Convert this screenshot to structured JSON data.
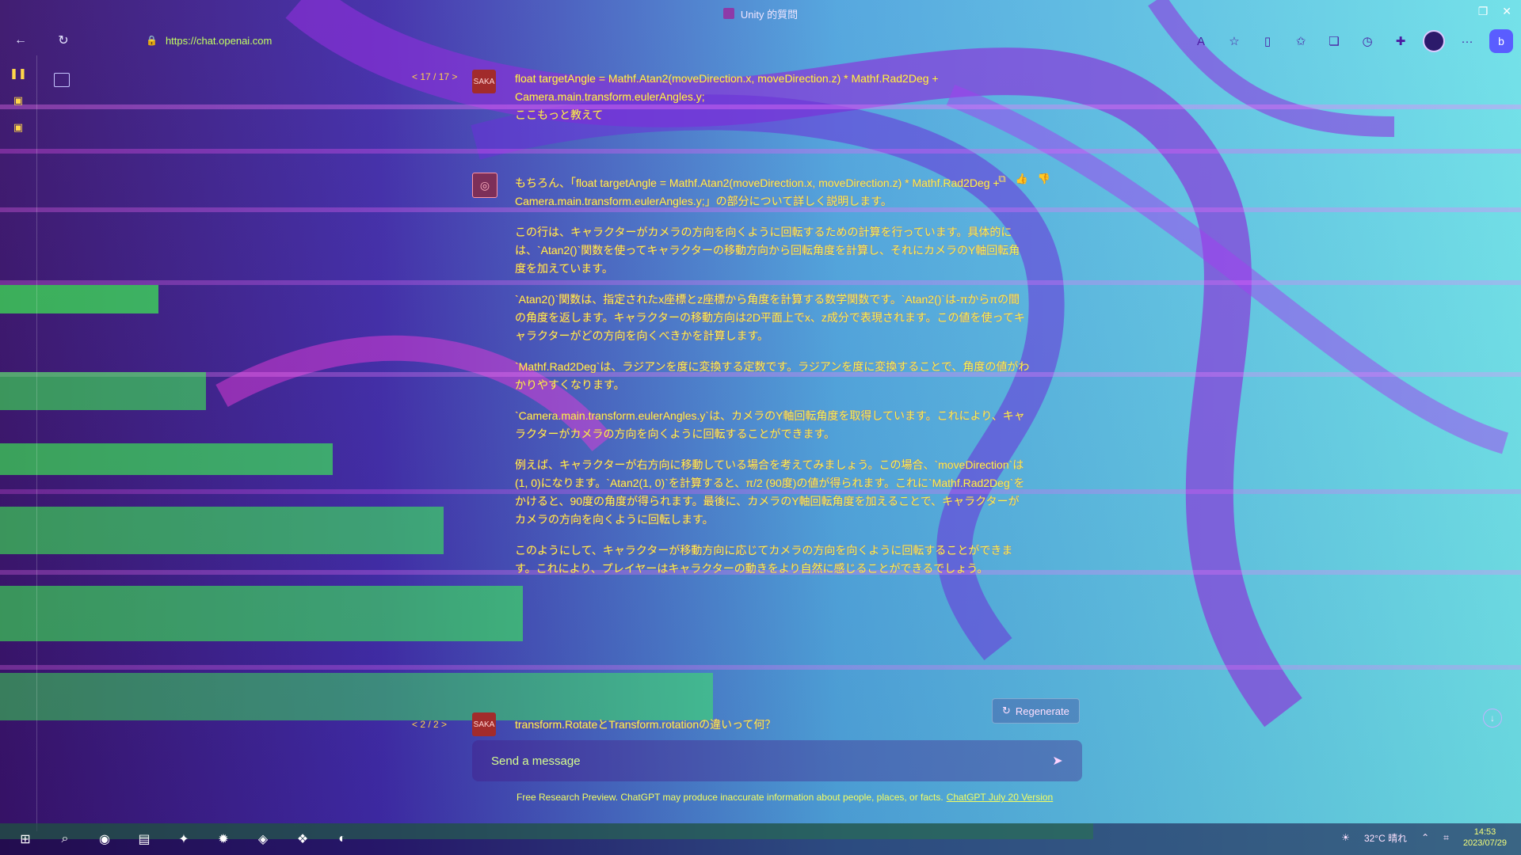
{
  "window": {
    "title": "Unity 的質問"
  },
  "browser": {
    "url": "https://chat.openai.com"
  },
  "conversation": {
    "user_message_1": {
      "pager": "< 17 / 17 >",
      "avatar_text": "SAKA",
      "line1": "float targetAngle = Mathf.Atan2(moveDirection.x, moveDirection.z) * Mathf.Rad2Deg +",
      "line2": "Camera.main.transform.eulerAngles.y;",
      "line3": "ここもっと教えて"
    },
    "assistant_message": {
      "paragraphs": [
        "もちろん、「float targetAngle = Mathf.Atan2(moveDirection.x, moveDirection.z) * Mathf.Rad2Deg + Camera.main.transform.eulerAngles.y;」の部分について詳しく説明します。",
        "この行は、キャラクターがカメラの方向を向くように回転するための計算を行っています。具体的には、`Atan2()`関数を使ってキャラクターの移動方向から回転角度を計算し、それにカメラのY軸回転角度を加えています。",
        "`Atan2()`関数は、指定されたx座標とz座標から角度を計算する数学関数です。`Atan2()`は-πからπの間の角度を返します。キャラクターの移動方向は2D平面上でx、z成分で表現されます。この値を使ってキャラクターがどの方向を向くべきかを計算します。",
        "`Mathf.Rad2Deg`は、ラジアンを度に変換する定数です。ラジアンを度に変換することで、角度の値がわかりやすくなります。",
        "`Camera.main.transform.eulerAngles.y`は、カメラのY軸回転角度を取得しています。これにより、キャラクターがカメラの方向を向くように回転することができます。",
        "例えば、キャラクターが右方向に移動している場合を考えてみましょう。この場合、`moveDirection`は(1, 0)になります。`Atan2(1, 0)`を計算すると、π/2 (90度)の値が得られます。これに`Mathf.Rad2Deg`をかけると、90度の角度が得られます。最後に、カメラのY軸回転角度を加えることで、キャラクターがカメラの方向を向くように回転します。",
        "このようにして、キャラクターが移動方向に応じてカメラの方向を向くように回転することができます。これにより、プレイヤーはキャラクターの動きをより自然に感じることができるでしょう。"
      ]
    },
    "user_message_2": {
      "pager": "< 2 / 2 >",
      "avatar_text": "SAKA",
      "text": "transform.RotateとTransform.rotationの違いって何？"
    }
  },
  "regenerate_label": "Regenerate",
  "composer": {
    "placeholder": "Send a message"
  },
  "footer": {
    "text": "Free Research Preview. ChatGPT may produce inaccurate information about people, places, or facts.",
    "link": "ChatGPT July 20 Version"
  },
  "taskbar": {
    "weather": "32°C 晴れ",
    "time": "14:53",
    "date": "2023/07/29"
  }
}
